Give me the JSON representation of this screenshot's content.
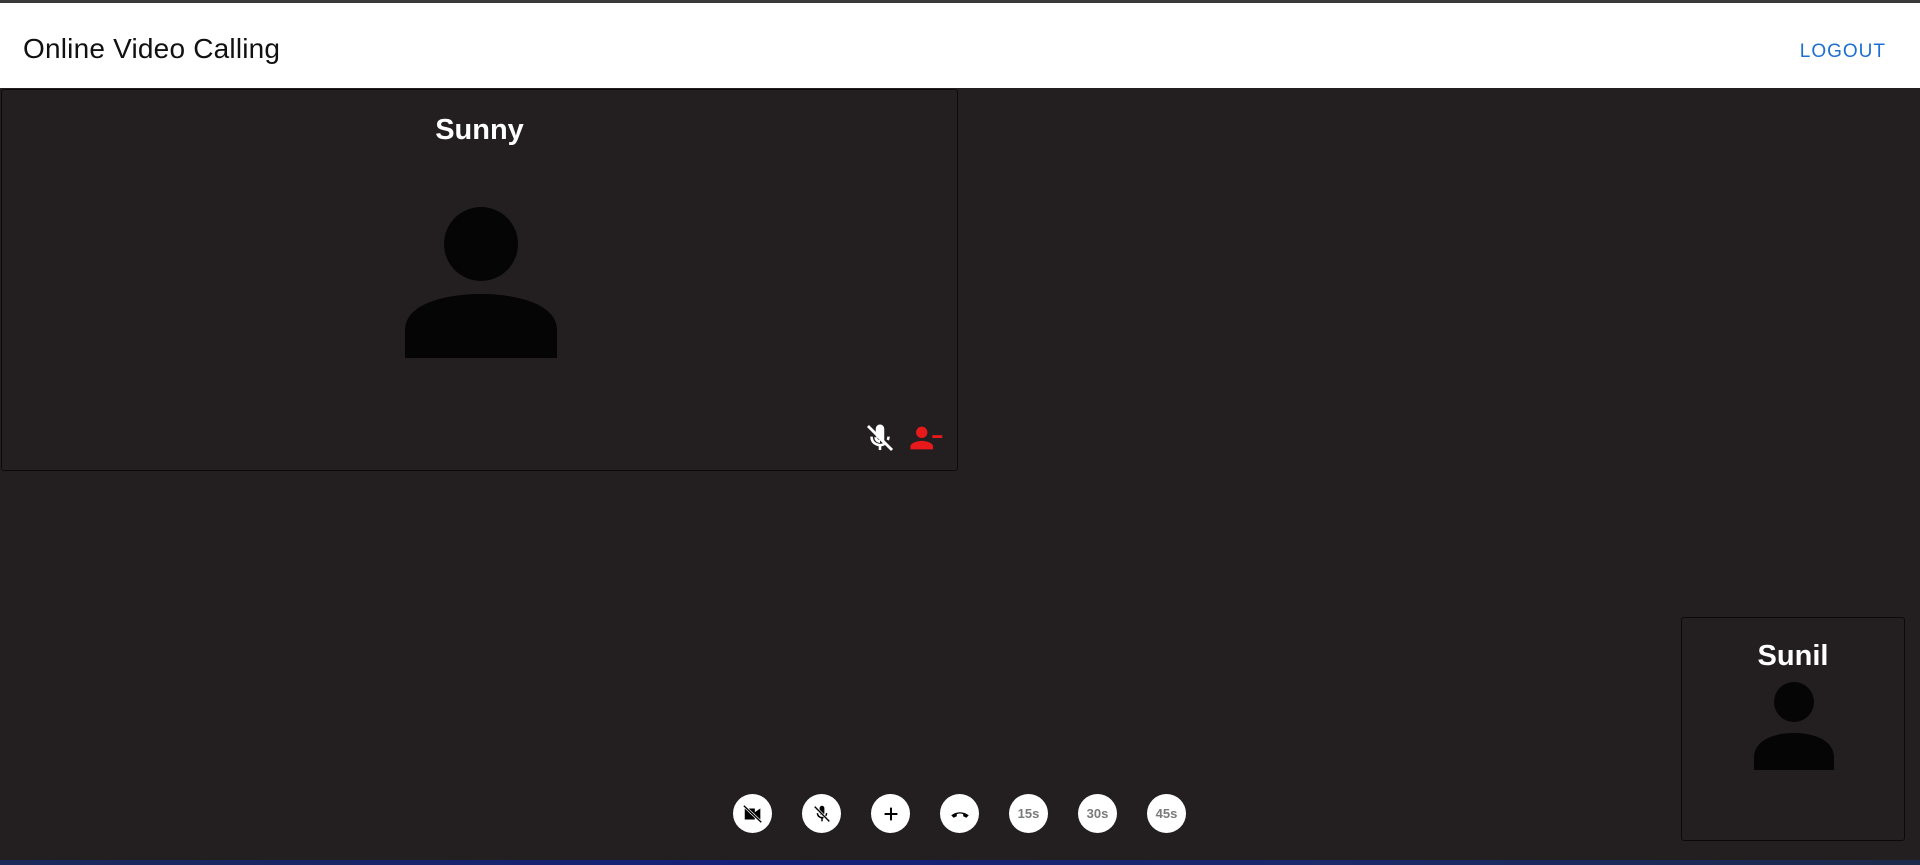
{
  "header": {
    "title": "Online Video Calling",
    "logout_label": "LOGOUT"
  },
  "remote_participant": {
    "name": "Sunny",
    "mic_icon": "mic-off-icon",
    "remove_icon": "remove-user-icon",
    "remove_color": "#e8191b"
  },
  "local_participant": {
    "name": "Sunil"
  },
  "controls": [
    {
      "name": "toggle-video-button",
      "icon": "video-off-icon"
    },
    {
      "name": "toggle-mic-button",
      "icon": "mic-off-icon"
    },
    {
      "name": "add-participant-button",
      "icon": "plus-icon"
    },
    {
      "name": "end-call-button",
      "icon": "hang-up-icon"
    },
    {
      "name": "timer-15s-button",
      "label": "15s"
    },
    {
      "name": "timer-30s-button",
      "label": "30s"
    },
    {
      "name": "timer-45s-button",
      "label": "45s"
    }
  ],
  "colors": {
    "background": "#231f20",
    "accent": "#1f6fd1",
    "danger": "#e8191b"
  }
}
